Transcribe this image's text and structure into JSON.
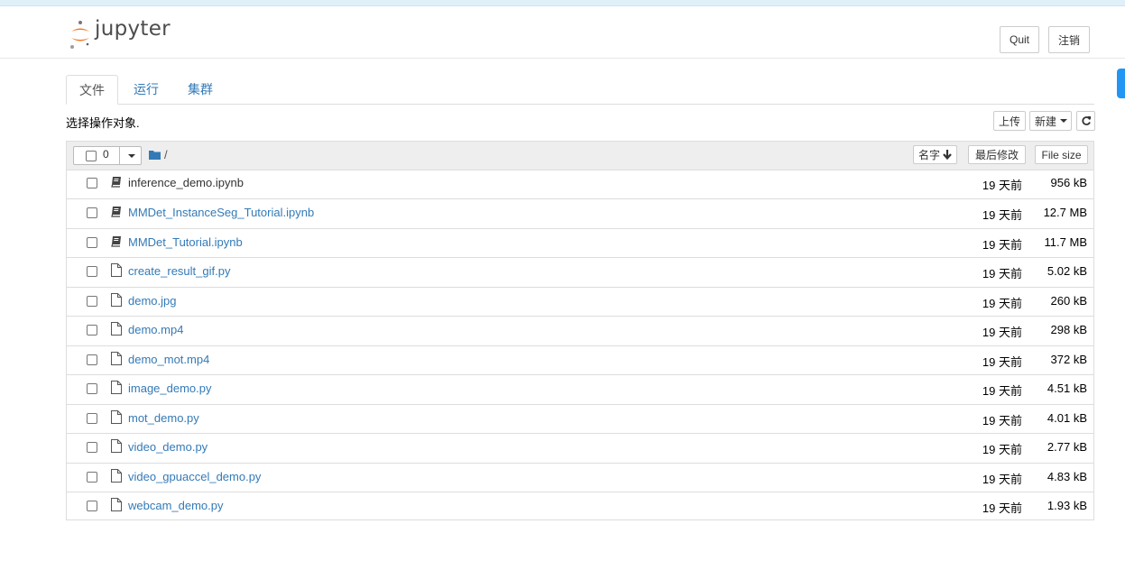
{
  "app": {
    "logo_text": "jupyter"
  },
  "header": {
    "quit_label": "Quit",
    "logout_label": "注销"
  },
  "tabs": [
    {
      "label": "文件",
      "active": true
    },
    {
      "label": "运行",
      "active": false
    },
    {
      "label": "集群",
      "active": false
    }
  ],
  "toolbar": {
    "hint": "选择操作对象.",
    "upload_label": "上传",
    "new_label": "新建"
  },
  "list_header": {
    "selected_count": "0",
    "path": "/",
    "sort_name_label": "名字",
    "last_modified_label": "最后修改",
    "file_size_label": "File size"
  },
  "files": [
    {
      "name": "inference_demo.ipynb",
      "type": "notebook",
      "modified": "19 天前",
      "size": "956 kB"
    },
    {
      "name": "MMDet_InstanceSeg_Tutorial.ipynb",
      "type": "notebook",
      "modified": "19 天前",
      "size": "12.7 MB"
    },
    {
      "name": "MMDet_Tutorial.ipynb",
      "type": "notebook",
      "modified": "19 天前",
      "size": "11.7 MB"
    },
    {
      "name": "create_result_gif.py",
      "type": "file",
      "modified": "19 天前",
      "size": "5.02 kB"
    },
    {
      "name": "demo.jpg",
      "type": "file",
      "modified": "19 天前",
      "size": "260 kB"
    },
    {
      "name": "demo.mp4",
      "type": "file",
      "modified": "19 天前",
      "size": "298 kB"
    },
    {
      "name": "demo_mot.mp4",
      "type": "file",
      "modified": "19 天前",
      "size": "372 kB"
    },
    {
      "name": "image_demo.py",
      "type": "file",
      "modified": "19 天前",
      "size": "4.51 kB"
    },
    {
      "name": "mot_demo.py",
      "type": "file",
      "modified": "19 天前",
      "size": "4.01 kB"
    },
    {
      "name": "video_demo.py",
      "type": "file",
      "modified": "19 天前",
      "size": "2.77 kB"
    },
    {
      "name": "video_gpuaccel_demo.py",
      "type": "file",
      "modified": "19 天前",
      "size": "4.83 kB"
    },
    {
      "name": "webcam_demo.py",
      "type": "file",
      "modified": "19 天前",
      "size": "1.93 kB"
    }
  ]
}
